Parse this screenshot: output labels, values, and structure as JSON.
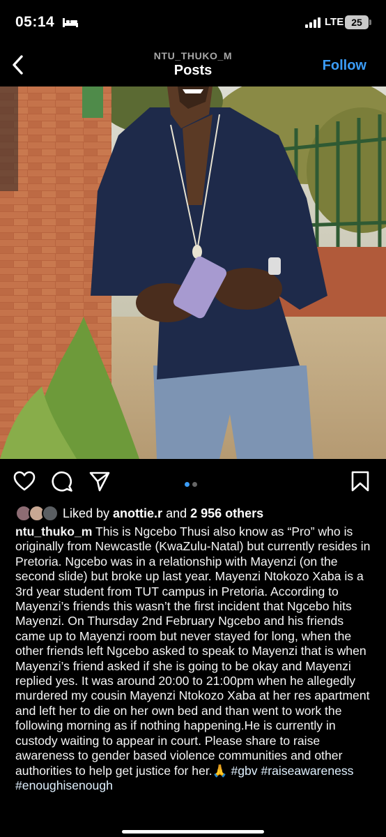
{
  "status_bar": {
    "time": "05:14",
    "network": "LTE",
    "battery": "25"
  },
  "header": {
    "username": "NTU_THUKO_M",
    "title": "Posts",
    "follow_label": "Follow"
  },
  "icons": {
    "back": "chevron-left-icon",
    "like": "heart-icon",
    "comment": "comment-icon",
    "share": "send-icon",
    "save": "bookmark-icon"
  },
  "colors": {
    "accent": "#3b9cf6",
    "background": "#000000"
  },
  "carousel": {
    "active_index": 1,
    "count": 2
  },
  "likes": {
    "prefix": "Liked by ",
    "user": "anottie.r",
    "middle": " and ",
    "others": "2 956 others"
  },
  "caption": {
    "username": "ntu_thuko_m",
    "text": " This is Ngcebo Thusi also know as “Pro” who is originally from Newcastle (KwaZulu-Natal) but currently resides in Pretoria. Ngcebo was in a relationship with Mayenzi (on the second slide) but broke up last year. Mayenzi Ntokozo Xaba is a 3rd year student from TUT campus in Pretoria. According to Mayenzi’s friends this wasn’t the first incident that Ngcebo hits Mayenzi. On Thursday 2nd February Ngcebo and his friends came up to Mayenzi room but never stayed for long, when the other friends left Ngcebo asked to speak to Mayenzi that is when Mayenzi’s friend asked if she is going to be okay and Mayenzi replied yes. It was around 20:00 to 21:00pm when he allegedly murdered my cousin Mayenzi Ntokozo Xaba at her res apartment and left her to die on her own bed and than went to work the following morning as if nothing happening.He is currently in custody waiting to appear in court. Please share to raise awareness to gender based violence communities and other authorities to help get justice for her.🙏 ",
    "hashtags": "#gbv #raiseawareness #enoughisenough"
  }
}
